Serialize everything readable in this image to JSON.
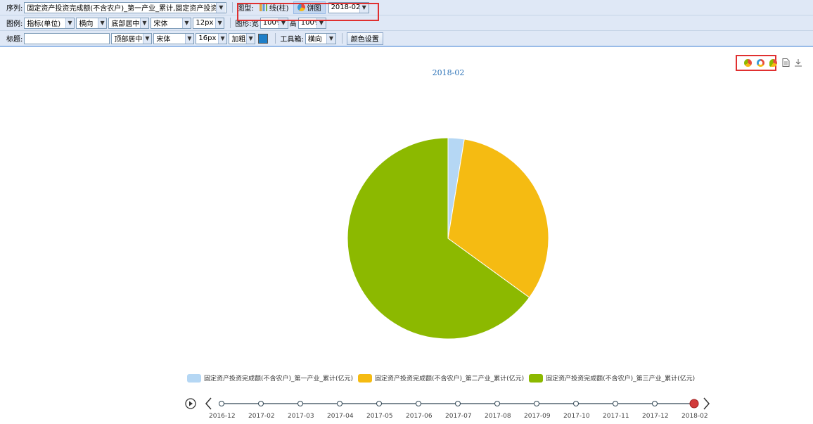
{
  "toolbar": {
    "series_label": "序列:",
    "series_value": "固定资产投资完成额(不含农户)_第一产业_累计,固定资产投资完成",
    "chart_type_label": "图型:",
    "line_bar_label": "线(柱)",
    "pie_label": "饼图",
    "period_value": "2018-02",
    "legend_label": "图例:",
    "legend_content_value": "指标(单位)",
    "legend_orient_value": "横向",
    "legend_pos_value": "底部居中",
    "legend_font_value": "宋体",
    "legend_size_value": "12px",
    "shape_label": "图形:宽",
    "width_value": "100%",
    "height_label": "高",
    "height_value": "100%",
    "title_label": "标题:",
    "title_input_value": "",
    "title_pos_value": "顶部居中",
    "title_font_value": "宋体",
    "title_size_value": "16px",
    "title_weight_value": "加粗",
    "title_color": "#1f7fc8",
    "toolbar_label": "工具箱:",
    "toolbar_orient_value": "横向",
    "color_settings_label": "颜色设置"
  },
  "chart_data": {
    "type": "pie",
    "title": "2018-02",
    "series": [
      {
        "name": "固定资产投资完成额(不含农户)_第一产业_累计(亿元)",
        "value": 2.6,
        "color": "#b5d7f4"
      },
      {
        "name": "固定资产投资完成额(不含农户)_第二产业_累计(亿元)",
        "value": 32.4,
        "color": "#f5bb12"
      },
      {
        "name": "固定资产投资完成额(不含农户)_第三产业_累计(亿元)",
        "value": 65.0,
        "color": "#8cb900"
      }
    ],
    "legend_position": "bottom-center"
  },
  "tools": [
    "pie-chart-icon",
    "ring-chart-icon",
    "rose-chart-icon",
    "data-view-icon",
    "download-icon"
  ],
  "timeline": {
    "dates": [
      "2016-12",
      "2017-02",
      "2017-03",
      "2017-04",
      "2017-05",
      "2017-06",
      "2017-07",
      "2017-08",
      "2017-09",
      "2017-10",
      "2017-11",
      "2017-12",
      "2018-02"
    ],
    "selected": "2018-02",
    "play_icon": "play-icon",
    "prev_icon": "chevron-left-icon",
    "next_icon": "chevron-right-icon"
  }
}
